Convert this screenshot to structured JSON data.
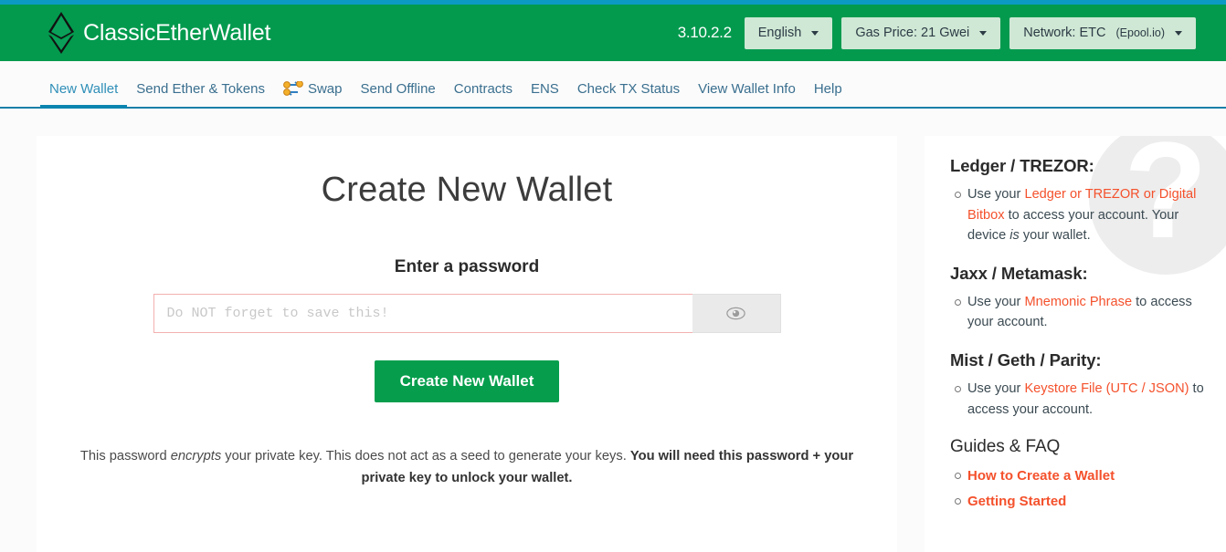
{
  "header": {
    "brand": "ClassicEtherWallet",
    "version": "3.10.2.2",
    "language": "English",
    "gas_price": "Gas Price: 21 Gwei",
    "network_main": "Network: ETC",
    "network_sub": "(Epool.io)",
    "brand_green": "#039a4e",
    "top_stripe_color": "#0c9ac4"
  },
  "nav": {
    "items": [
      {
        "label": "New Wallet",
        "active": true
      },
      {
        "label": "Send Ether & Tokens",
        "active": false
      },
      {
        "label": "Swap",
        "active": false,
        "icon": "swap-icon"
      },
      {
        "label": "Send Offline",
        "active": false
      },
      {
        "label": "Contracts",
        "active": false
      },
      {
        "label": "ENS",
        "active": false
      },
      {
        "label": "Check TX Status",
        "active": false
      },
      {
        "label": "View Wallet Info",
        "active": false
      },
      {
        "label": "Help",
        "active": false
      }
    ],
    "active_color": "#0b85b0",
    "link_color": "#3a6f8f"
  },
  "main": {
    "title": "Create New Wallet",
    "password_label": "Enter a password",
    "password_value": "",
    "password_placeholder": "Do NOT forget to save this!",
    "toggle_visibility_icon": "eye-icon",
    "create_button": "Create New Wallet",
    "create_button_color": "#069e4d",
    "disclaimer": {
      "part1": "This password ",
      "emphasis": "encrypts",
      "part2": " your private key. This does not act as a seed to generate your keys. ",
      "strong": "You will need this password + your private key to unlock your wallet."
    }
  },
  "sidebar": {
    "watermark": "?",
    "link_color": "#f4512c",
    "groups": [
      {
        "heading": "Ledger / TREZOR:",
        "heading_style": "bold",
        "items": [
          {
            "before": "Use your ",
            "link": "Ledger or TREZOR or Digital Bitbox",
            "after": " to access your account. Your device ",
            "italic": "is",
            "tail": " your wallet."
          }
        ]
      },
      {
        "heading": "Jaxx / Metamask:",
        "heading_style": "bold",
        "items": [
          {
            "before": "Use your ",
            "link": "Mnemonic Phrase",
            "after": " to access your account.",
            "italic": "",
            "tail": ""
          }
        ]
      },
      {
        "heading": "Mist / Geth / Parity:",
        "heading_style": "bold",
        "items": [
          {
            "before": "Use your ",
            "link": "Keystore File (UTC / JSON)",
            "after": " to access your account.",
            "italic": "",
            "tail": ""
          }
        ]
      },
      {
        "heading": "Guides & FAQ",
        "heading_style": "light",
        "items": [
          {
            "before": "",
            "link": "How to Create a Wallet",
            "after": "",
            "italic": "",
            "tail": ""
          },
          {
            "before": "",
            "link": "Getting Started",
            "after": "",
            "italic": "",
            "tail": ""
          }
        ]
      }
    ]
  }
}
